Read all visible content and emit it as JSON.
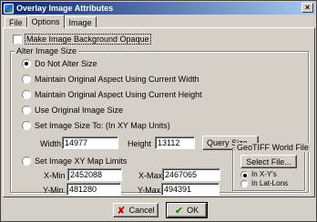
{
  "window": {
    "title": "Overlay Image Attributes",
    "close_glyph": "×"
  },
  "tabs": [
    {
      "label": "File"
    },
    {
      "label": "Options"
    },
    {
      "label": "Image"
    }
  ],
  "options": {
    "opaque_label": "Make Image Background Opaque",
    "opaque_checked": false,
    "alter_size": {
      "title": "Alter Image Size",
      "radios": [
        {
          "label": "Do Not Alter Size",
          "selected": true
        },
        {
          "label": "Maintain Original Aspect Using Current Width",
          "selected": false
        },
        {
          "label": "Maintain Original Aspect Using Current Height",
          "selected": false
        },
        {
          "label": "Use Original Image Size",
          "selected": false
        },
        {
          "label": "Set Image Size To:  (In XY Map Units)",
          "selected": false
        },
        {
          "label": "Set Image XY Map Limits",
          "selected": false
        }
      ],
      "width_label": "Width",
      "width_value": "14977",
      "height_label": "Height",
      "height_value": "13112",
      "query_size_label": "Query Size...",
      "xmin_label": "X-Min",
      "xmin_value": "2452088",
      "xmax_label": "X-Max",
      "xmax_value": "2467065",
      "ymin_label": "Y-Min",
      "ymin_value": "481280",
      "ymax_label": "Y-Max",
      "ymax_value": "494391"
    },
    "geotiff": {
      "title": "GeoTIFF World File",
      "select_file_label": "Select File...",
      "radios": [
        {
          "label": "In X-Y's",
          "selected": true
        },
        {
          "label": "In Lat-Lons",
          "selected": false
        }
      ]
    }
  },
  "footer": {
    "cancel_label": "Cancel",
    "ok_label": "OK",
    "cancel_glyph": "✘",
    "ok_glyph": "✔"
  }
}
